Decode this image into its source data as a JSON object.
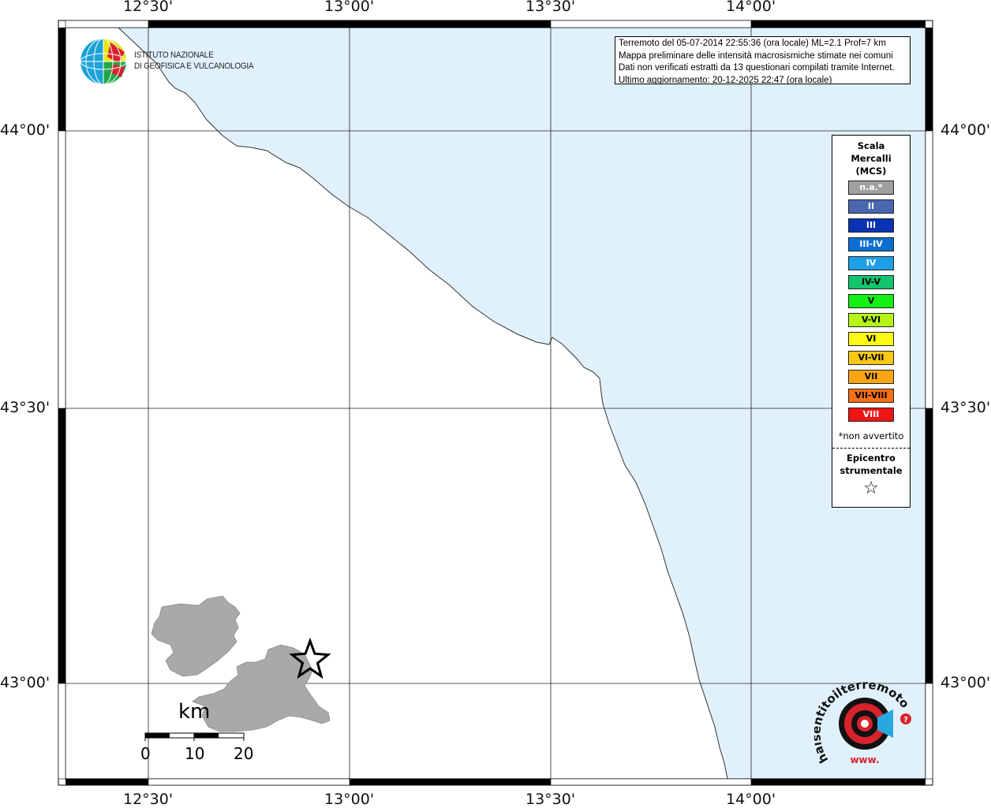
{
  "map": {
    "lon_ticks": [
      "12°30'",
      "13°00'",
      "13°30'",
      "14°00'"
    ],
    "lat_ticks": [
      "44°00'",
      "43°30'",
      "43°00'"
    ],
    "sea_color": "#e0f1fc",
    "land_color": "#ffffff",
    "region_fill_color": "#a9a9a9"
  },
  "info": {
    "line1": "Terremoto del 05-07-2014 22:55:36 (ora locale) ML=2.1 Prof=7 km",
    "line2": "Mappa preliminare delle intensità macrosismiche stimate nei comuni",
    "line3": "Dati non verificati estratti da 13 questionari compilati tramite Internet.",
    "line4": "Ultimo aggiornamento: 20-12-2025 22:47 (ora locale)"
  },
  "legend": {
    "title_line1": "Scala",
    "title_line2": "Mercalli",
    "title_line3": "(MCS)",
    "items": [
      {
        "label": "n.a.*",
        "color": "#a0a0a0",
        "text_color": "#ffffff"
      },
      {
        "label": "II",
        "color": "#4b66b0",
        "text_color": "#ffffff"
      },
      {
        "label": "III",
        "color": "#0a32b4",
        "text_color": "#ffffff"
      },
      {
        "label": "III-IV",
        "color": "#0a6ed2",
        "text_color": "#ffffff"
      },
      {
        "label": "IV",
        "color": "#1ea0e6",
        "text_color": "#ffffff"
      },
      {
        "label": "IV-V",
        "color": "#14c36e",
        "text_color": "#000000"
      },
      {
        "label": "V",
        "color": "#14f014",
        "text_color": "#000000"
      },
      {
        "label": "V-VI",
        "color": "#b4f514",
        "text_color": "#000000"
      },
      {
        "label": "VI",
        "color": "#fafa14",
        "text_color": "#000000"
      },
      {
        "label": "VI-VII",
        "color": "#fac814",
        "text_color": "#000000"
      },
      {
        "label": "VII",
        "color": "#faa514",
        "text_color": "#000000"
      },
      {
        "label": "VII-VIII",
        "color": "#fa6e14",
        "text_color": "#000000"
      },
      {
        "label": "VIII",
        "color": "#f01414",
        "text_color": "#ffffff"
      }
    ],
    "note": "*non avvertito",
    "epicenter_line1": "Epicentro",
    "epicenter_line2": "strumentale",
    "epicenter_symbol": "☆"
  },
  "logo": {
    "line1": "ISTITUTO NAZIONALE",
    "line2": "DI GEOFISICA E VULCANOLOGIA"
  },
  "scalebar": {
    "unit": "km",
    "labels": [
      "0",
      "10",
      "20"
    ]
  },
  "hst_logo": {
    "text": "haisentitoilterremoto.it",
    "prefix": "www."
  }
}
